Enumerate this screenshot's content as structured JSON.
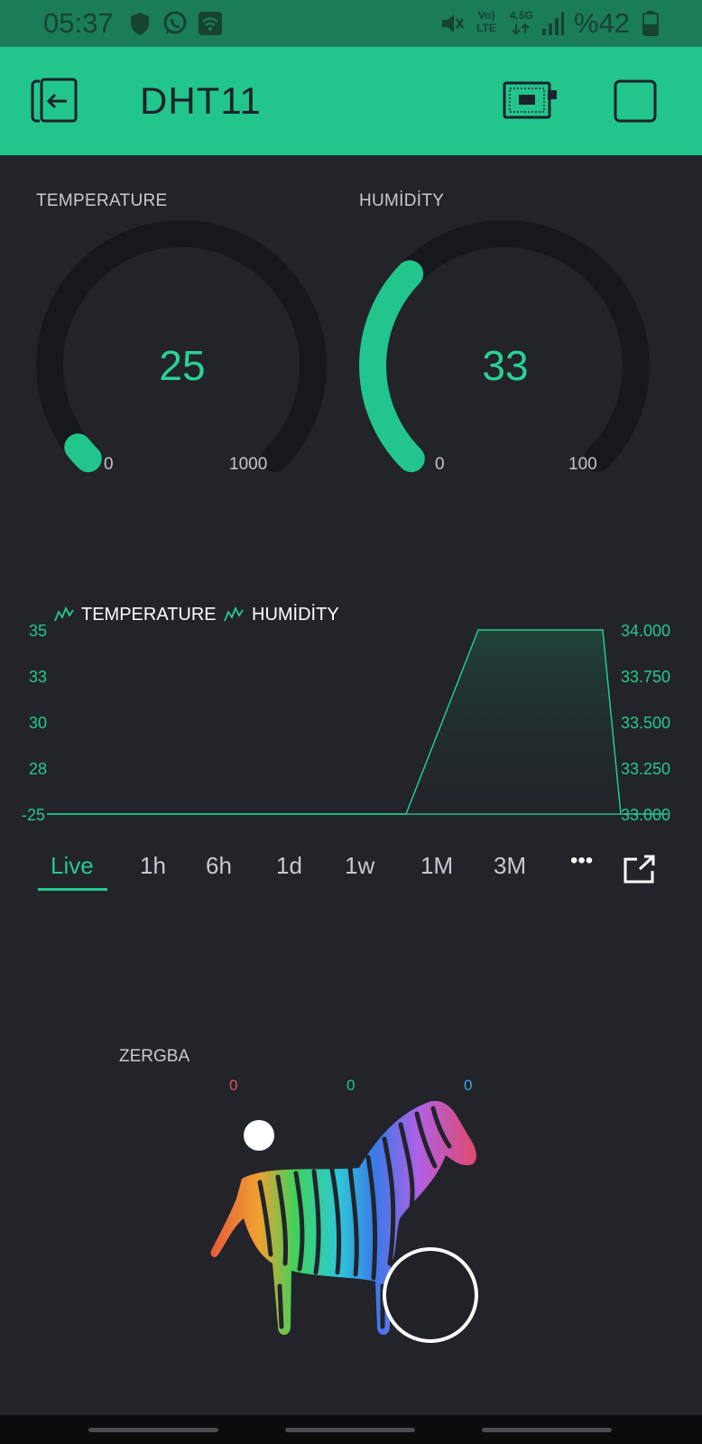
{
  "status_bar": {
    "time": "05:37",
    "network_lte": "Vo) LTE",
    "network_45g": "4.5G",
    "battery": "%42"
  },
  "app_bar": {
    "title": "DHT11",
    "icons": [
      "exit-icon",
      "device-board-icon",
      "stop-icon"
    ]
  },
  "gauges": [
    {
      "label": "TEMPERATURE",
      "value": "25",
      "min": "0",
      "max": "1000",
      "fraction": 0.025
    },
    {
      "label": "HUMİDİTY",
      "value": "33",
      "min": "0",
      "max": "100",
      "fraction": 0.33
    }
  ],
  "chart": {
    "legend": [
      "TEMPERATURE",
      "HUMİDİTY"
    ],
    "left_ticks": [
      "35",
      "33",
      "30",
      "28",
      "-25"
    ],
    "right_ticks": [
      "34.000",
      "33.750",
      "33.500",
      "33.250",
      "33.000"
    ],
    "accent": "#26c98f"
  },
  "chart_data": {
    "type": "area",
    "series": [
      {
        "name": "TEMPERATURE",
        "values": [
          -25,
          -25,
          -25,
          -25,
          -25,
          -25,
          -25,
          -25
        ]
      },
      {
        "name": "HUMİDİTY",
        "values": [
          33.0,
          33.0,
          33.0,
          33.0,
          33.0,
          34.0,
          34.0,
          33.0
        ]
      }
    ],
    "y_left_range": [
      -25,
      35
    ],
    "y_right_range": [
      33.0,
      34.0
    ]
  },
  "time_tabs": {
    "items": [
      "Live",
      "1h",
      "6h",
      "1d",
      "1w",
      "1M",
      "3M"
    ],
    "active": "Live",
    "more": "•••"
  },
  "zergba": {
    "label": "ZERGBA",
    "r": "0",
    "g": "0",
    "b": "0"
  }
}
